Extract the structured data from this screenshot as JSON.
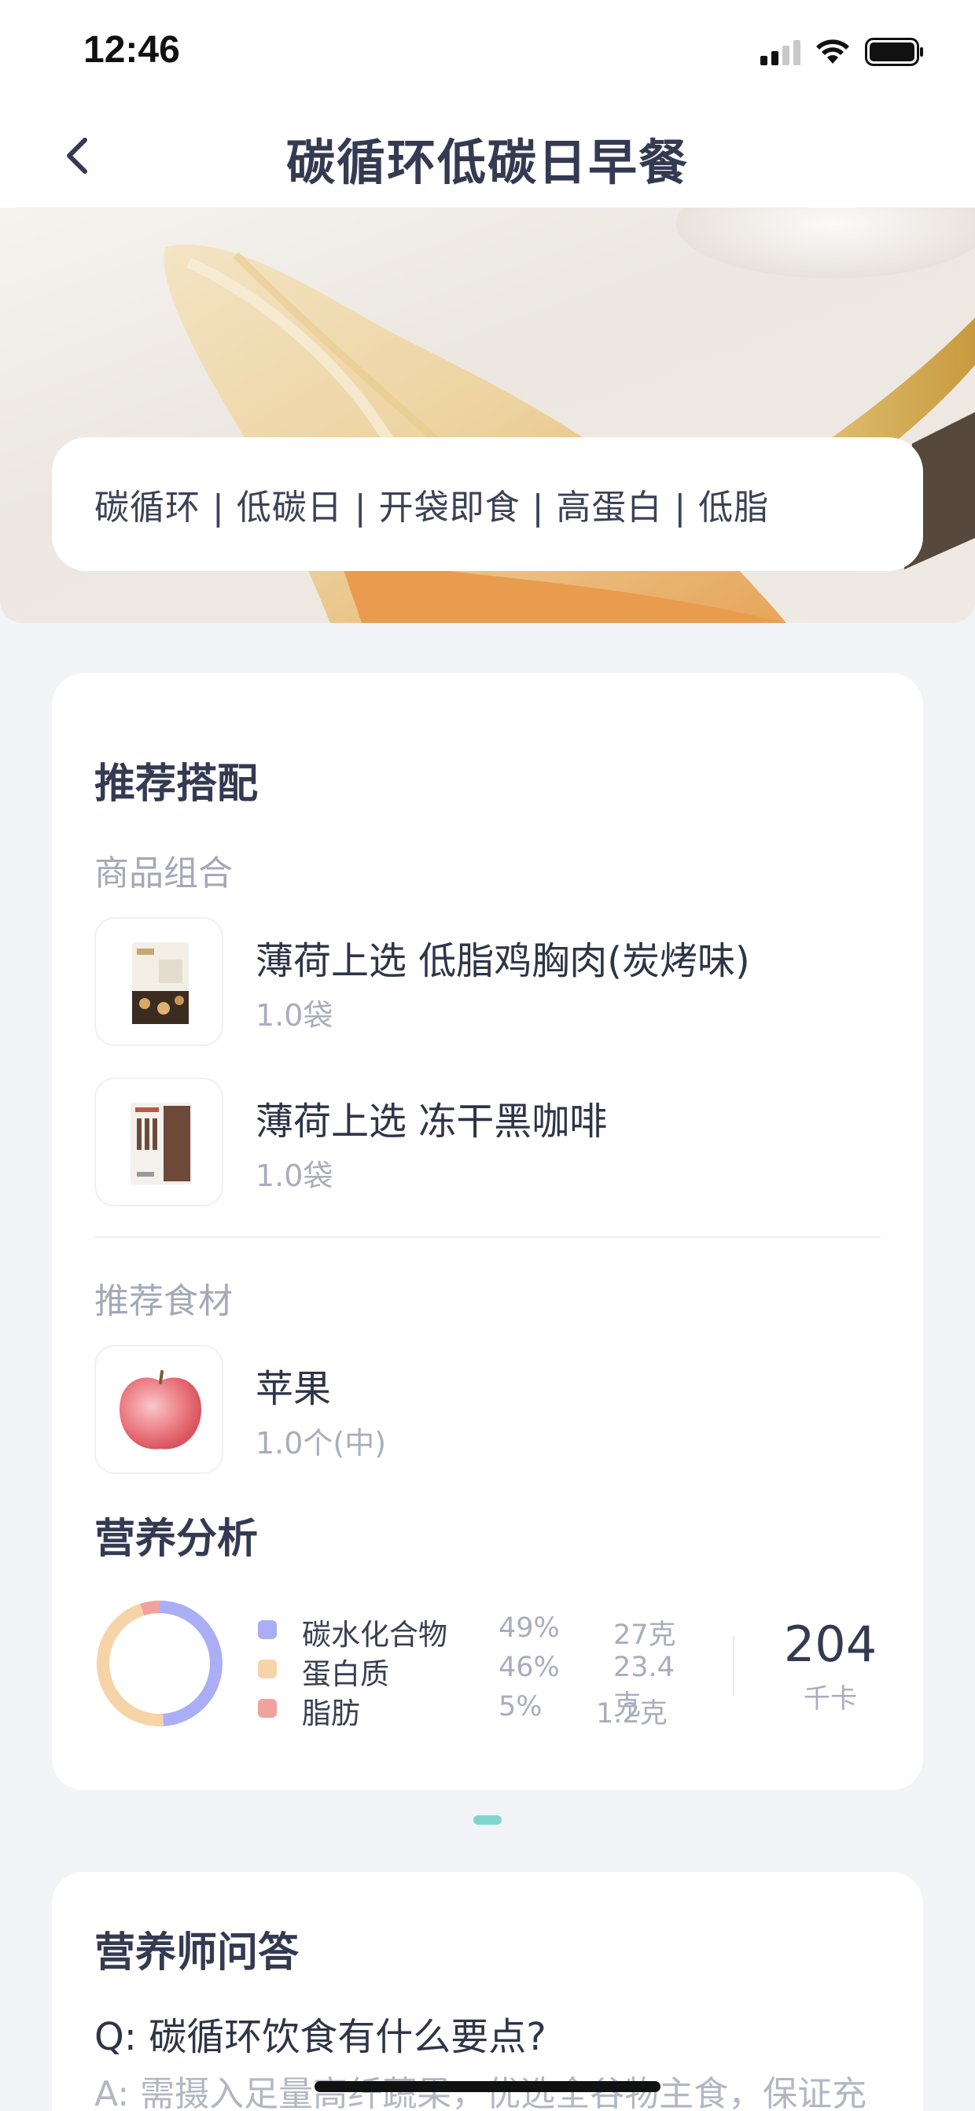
{
  "status_bar": {
    "time": "12:46"
  },
  "nav": {
    "title": "碳循环低碳日早餐"
  },
  "hero": {
    "tags": "碳循环 | 低碳日 | 开袋即食 | 高蛋白 | 低脂"
  },
  "recommend": {
    "title": "推荐搭配",
    "products_label": "商品组合",
    "products": [
      {
        "name": "薄荷上选 低脂鸡胸肉(炭烤味)",
        "qty": "1.0袋"
      },
      {
        "name": "薄荷上选 冻干黑咖啡",
        "qty": "1.0袋"
      }
    ],
    "ingredients_label": "推荐食材",
    "ingredients": [
      {
        "name": "苹果",
        "qty": "1.0个(中)"
      }
    ]
  },
  "nutrition": {
    "title": "营养分析",
    "items": [
      {
        "name": "碳水化合物",
        "percent": "49%",
        "amount": "27克",
        "color": "#aaaef5",
        "value": 49
      },
      {
        "name": "蛋白质",
        "percent": "46%",
        "amount": "23.4克",
        "color": "#f7d3a8",
        "value": 46
      },
      {
        "name": "脂肪",
        "percent": "5%",
        "amount": "1.2克",
        "color": "#f0a39e",
        "value": 5
      }
    ],
    "kcal_value": "204",
    "kcal_unit": "千卡"
  },
  "qa": {
    "title": "营养师问答",
    "question": "Q: 碳循环饮食有什么要点?",
    "answer": "A: 需摄入足量高纤蔬果，优选全谷物主食，保证充"
  }
}
